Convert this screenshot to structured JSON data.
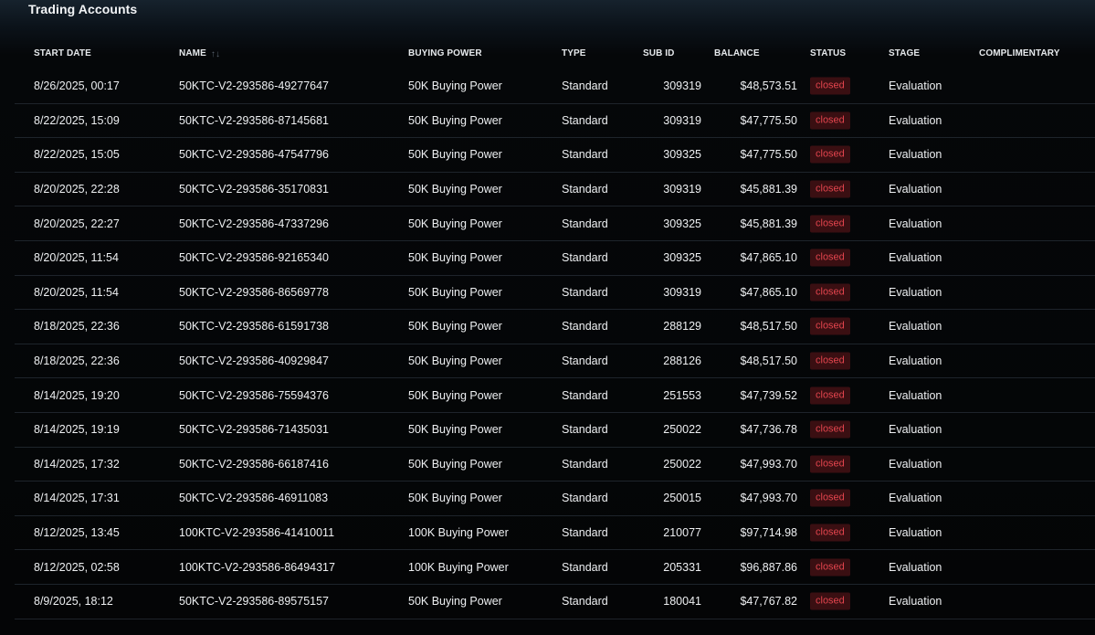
{
  "title": "Trading Accounts",
  "columns": {
    "start_date": "START DATE",
    "name": "NAME",
    "buying_power": "BUYING POWER",
    "type": "TYPE",
    "sub_id": "SUB ID",
    "balance": "BALANCE",
    "status": "STATUS",
    "stage": "STAGE",
    "complimentary": "COMPLIMENTARY"
  },
  "rows": [
    {
      "start_date": "8/26/2025, 00:17",
      "name": "50KTC-V2-293586-49277647",
      "buying_power": "50K Buying Power",
      "type": "Standard",
      "sub_id": "309319",
      "balance": "$48,573.51",
      "status": "closed",
      "stage": "Evaluation",
      "complimentary": ""
    },
    {
      "start_date": "8/22/2025, 15:09",
      "name": "50KTC-V2-293586-87145681",
      "buying_power": "50K Buying Power",
      "type": "Standard",
      "sub_id": "309319",
      "balance": "$47,775.50",
      "status": "closed",
      "stage": "Evaluation",
      "complimentary": ""
    },
    {
      "start_date": "8/22/2025, 15:05",
      "name": "50KTC-V2-293586-47547796",
      "buying_power": "50K Buying Power",
      "type": "Standard",
      "sub_id": "309325",
      "balance": "$47,775.50",
      "status": "closed",
      "stage": "Evaluation",
      "complimentary": ""
    },
    {
      "start_date": "8/20/2025, 22:28",
      "name": "50KTC-V2-293586-35170831",
      "buying_power": "50K Buying Power",
      "type": "Standard",
      "sub_id": "309319",
      "balance": "$45,881.39",
      "status": "closed",
      "stage": "Evaluation",
      "complimentary": ""
    },
    {
      "start_date": "8/20/2025, 22:27",
      "name": "50KTC-V2-293586-47337296",
      "buying_power": "50K Buying Power",
      "type": "Standard",
      "sub_id": "309325",
      "balance": "$45,881.39",
      "status": "closed",
      "stage": "Evaluation",
      "complimentary": ""
    },
    {
      "start_date": "8/20/2025, 11:54",
      "name": "50KTC-V2-293586-92165340",
      "buying_power": "50K Buying Power",
      "type": "Standard",
      "sub_id": "309325",
      "balance": "$47,865.10",
      "status": "closed",
      "stage": "Evaluation",
      "complimentary": ""
    },
    {
      "start_date": "8/20/2025, 11:54",
      "name": "50KTC-V2-293586-86569778",
      "buying_power": "50K Buying Power",
      "type": "Standard",
      "sub_id": "309319",
      "balance": "$47,865.10",
      "status": "closed",
      "stage": "Evaluation",
      "complimentary": ""
    },
    {
      "start_date": "8/18/2025, 22:36",
      "name": "50KTC-V2-293586-61591738",
      "buying_power": "50K Buying Power",
      "type": "Standard",
      "sub_id": "288129",
      "balance": "$48,517.50",
      "status": "closed",
      "stage": "Evaluation",
      "complimentary": ""
    },
    {
      "start_date": "8/18/2025, 22:36",
      "name": "50KTC-V2-293586-40929847",
      "buying_power": "50K Buying Power",
      "type": "Standard",
      "sub_id": "288126",
      "balance": "$48,517.50",
      "status": "closed",
      "stage": "Evaluation",
      "complimentary": ""
    },
    {
      "start_date": "8/14/2025, 19:20",
      "name": "50KTC-V2-293586-75594376",
      "buying_power": "50K Buying Power",
      "type": "Standard",
      "sub_id": "251553",
      "balance": "$47,739.52",
      "status": "closed",
      "stage": "Evaluation",
      "complimentary": ""
    },
    {
      "start_date": "8/14/2025, 19:19",
      "name": "50KTC-V2-293586-71435031",
      "buying_power": "50K Buying Power",
      "type": "Standard",
      "sub_id": "250022",
      "balance": "$47,736.78",
      "status": "closed",
      "stage": "Evaluation",
      "complimentary": ""
    },
    {
      "start_date": "8/14/2025, 17:32",
      "name": "50KTC-V2-293586-66187416",
      "buying_power": "50K Buying Power",
      "type": "Standard",
      "sub_id": "250022",
      "balance": "$47,993.70",
      "status": "closed",
      "stage": "Evaluation",
      "complimentary": ""
    },
    {
      "start_date": "8/14/2025, 17:31",
      "name": "50KTC-V2-293586-46911083",
      "buying_power": "50K Buying Power",
      "type": "Standard",
      "sub_id": "250015",
      "balance": "$47,993.70",
      "status": "closed",
      "stage": "Evaluation",
      "complimentary": ""
    },
    {
      "start_date": "8/12/2025, 13:45",
      "name": "100KTC-V2-293586-41410011",
      "buying_power": "100K Buying Power",
      "type": "Standard",
      "sub_id": "210077",
      "balance": "$97,714.98",
      "status": "closed",
      "stage": "Evaluation",
      "complimentary": ""
    },
    {
      "start_date": "8/12/2025, 02:58",
      "name": "100KTC-V2-293586-86494317",
      "buying_power": "100K Buying Power",
      "type": "Standard",
      "sub_id": "205331",
      "balance": "$96,887.86",
      "status": "closed",
      "stage": "Evaluation",
      "complimentary": ""
    },
    {
      "start_date": "8/9/2025, 18:12",
      "name": "50KTC-V2-293586-89575157",
      "buying_power": "50K Buying Power",
      "type": "Standard",
      "sub_id": "180041",
      "balance": "$47,767.82",
      "status": "closed",
      "stage": "Evaluation",
      "complimentary": ""
    }
  ],
  "icons": {
    "sort": "sort-arrows-icon"
  },
  "colors": {
    "status_closed_text": "#e2444d",
    "status_closed_bg": "#3a0f12",
    "row_divider": "#1e242b",
    "background": "#040506"
  }
}
